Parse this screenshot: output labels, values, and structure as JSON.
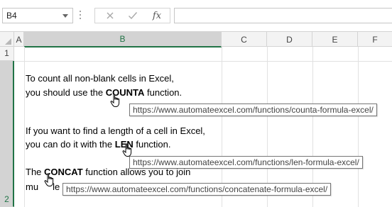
{
  "formula_bar": {
    "name_box": "B4",
    "cancel_icon": "x-icon",
    "enter_icon": "check-icon",
    "function_label": "fx",
    "formula_value": ""
  },
  "columns": [
    "A",
    "B",
    "C",
    "D",
    "E",
    "F"
  ],
  "selected_column": "B",
  "rows": [
    "1",
    "2"
  ],
  "cell_b2": {
    "line1_text": "To count all non-blank cells in Excel,",
    "line2_pre": "you should use the ",
    "line2_link": "COUNTA",
    "line2_post": " function.",
    "para2_line1": "If you want to find a length of a cell in Excel,",
    "para2_line2_pre": "you can do it with the ",
    "para2_line2_link": "LEN",
    "para2_line2_post": " function.",
    "para3_line1_pre": "The ",
    "para3_line1_link": "CONCAT",
    "para3_line1_post": " function allows you to join",
    "para3_line2_a": "mu",
    "para3_line2_b": "le"
  },
  "tooltips": {
    "counta": "https://www.automateexcel.com/functions/counta-formula-excel/",
    "len": "https://www.automateexcel.com/functions/len-formula-excel/",
    "concat": "https://www.automateexcel.com/functions/concatenate-formula-excel/"
  },
  "colors": {
    "accent": "#217346",
    "header_bg": "#f3f3f3",
    "selected_header_bg": "#d3d3d3",
    "gridline": "#e1e1e1"
  }
}
